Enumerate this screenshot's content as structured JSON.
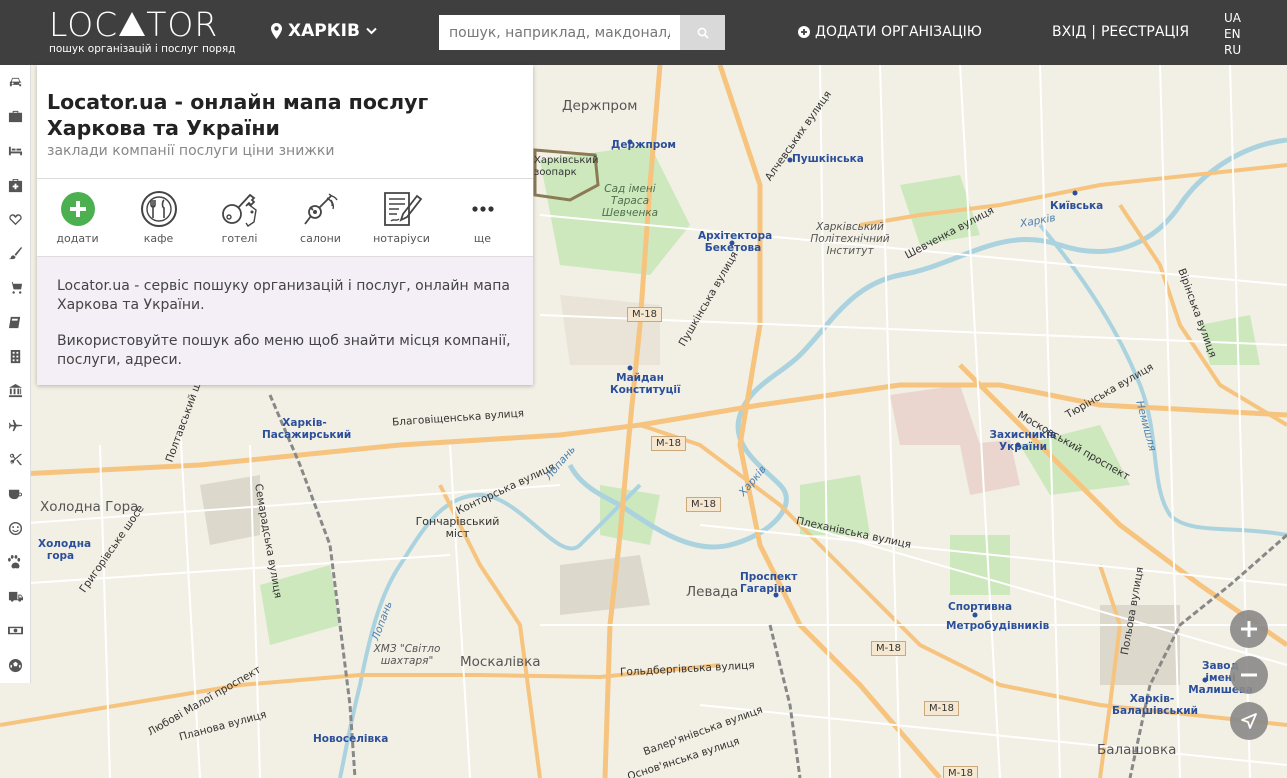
{
  "header": {
    "logo_text_left": "LOC",
    "logo_text_right": "TOR",
    "logo_tagline": "пошук організацій і послуг поряд",
    "city": "ХАРКІВ",
    "search_placeholder": "пошук, наприклад, макдоналдс",
    "add_org": "ДОДАТИ ОРГАНІЗАЦІЮ",
    "login": "ВХІД",
    "separator": "|",
    "register": "РЕЄСТРАЦІЯ",
    "languages": [
      "UA",
      "EN",
      "RU"
    ]
  },
  "toolbar": {
    "icons": [
      "car-icon",
      "briefcase-icon",
      "bed-icon",
      "medkit-icon",
      "heart-icon",
      "brush-icon",
      "cart-icon",
      "book-icon",
      "building-icon",
      "bank-icon",
      "plane-icon",
      "scissors-icon",
      "coffee-icon",
      "smile-icon",
      "paw-icon",
      "truck-icon",
      "money-icon",
      "football-icon"
    ]
  },
  "panel": {
    "title": "Locator.ua - онлайн мапа послуг Харкова та України",
    "subtitle": "заклади компанії послуги ціни знижки",
    "categories": [
      {
        "label": "додати",
        "icon": "plus-circle-icon"
      },
      {
        "label": "кафе",
        "icon": "cafe-icon"
      },
      {
        "label": "готелі",
        "icon": "hotel-key-icon"
      },
      {
        "label": "салони",
        "icon": "salon-dryer-icon"
      },
      {
        "label": "нотаріуси",
        "icon": "notary-icon"
      },
      {
        "label": "ще",
        "icon": "more-icon"
      }
    ],
    "info_p1": "Locator.ua - сервіс пошуку организацій і послуг, онлайн мапа Харкова та України.",
    "info_p2": "Використовуйте пошук або меню щоб знайти місця компанії, послуги, адреси."
  },
  "map": {
    "labels": {
      "derzhprom_big": "Держпром",
      "derzhprom": "Держпром",
      "zoo": "Харківський зоопарк",
      "garden": "Сад імені Тараса Шевченка",
      "pushkinska": "Пушкінська",
      "polytech": "Харківський Політехнічний Інститут",
      "beketova": "Архітектора Бекетова",
      "kyivska": "Київська",
      "maidan": "Майдан Конституції",
      "pasazhyrskyi": "Харків-Пасажирський",
      "kholodna_hora_big": "Холодна Гора",
      "kholodna_hora": "Холодна гора",
      "honcharivskyi": "Гончарівський міст",
      "levada": "Левада",
      "gagarina": "Проспект Гагаріна",
      "zakhysnykiv": "Захисників України",
      "sportyvna": "Спортивна",
      "metrobudivnykiv": "Метробудівників",
      "moskalivka": "Москалівка",
      "khmz": "ХМЗ \"Світло шахтаря\"",
      "novoselivka": "Новоселівка",
      "malysheva": "Завод імені Малишева",
      "balashivskyi": "Харків-Балашівський",
      "balashivka": "Балашовка",
      "blahovishchenska": "Благовіщенська вулиця",
      "kontorska": "Конторська вулиця",
      "poltavskyi": "Полтавський шлях",
      "plekhanivska": "Плеханівська вулиця",
      "moskovskyi": "Московський проспект",
      "shevchenka": "Шевченка вулиця",
      "pushkinska_st": "Пушкінська вулиця",
      "alchevskykh": "Алчевських вулиця",
      "goldbergivska": "Гольдбергівська вулиця",
      "valerianivska": "Валер'янівська вулиця",
      "osnovianska": "Основ'янська вулиця",
      "semaradska": "Семарадська вулиця",
      "poltavska_st": "Польова вулиця",
      "tiurinska": "Тюрінська вулиця",
      "virinska": "Вірінська вулиця",
      "hryhorivske": "Григорівське шосе",
      "lybovi_maloi": "Любові Малої проспект",
      "plantova": "Планова вулиця",
      "lopan": "Лопань",
      "lopan2": "Лопань",
      "kharkiv_river": "Харків",
      "kharkiv_river2": "Харків",
      "nemyshlia": "Немишля",
      "m18": "М-18"
    }
  }
}
